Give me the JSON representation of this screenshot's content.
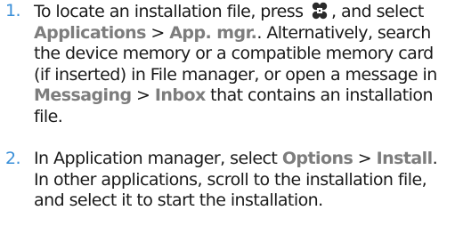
{
  "steps": [
    {
      "number": "1.",
      "t1": "To locate an installation file, press",
      "icon": "menu-key-icon",
      "t2": ", and select",
      "k1": "Applications",
      "s1": ">",
      "k2": "App. mgr.",
      "t3": ". Alternatively, search the device memory or a compatible memory card (if inserted) in File manager, or open a message in",
      "k3": "Messaging",
      "s2": ">",
      "k4": "Inbox",
      "t4": "that contains an installation file."
    },
    {
      "number": "2.",
      "t1": "In Application manager, select",
      "k1": "Options",
      "s1": ">",
      "k2": "Install",
      "t2": ". In other applications, scroll to the installation file, and select it to start the installation."
    }
  ]
}
